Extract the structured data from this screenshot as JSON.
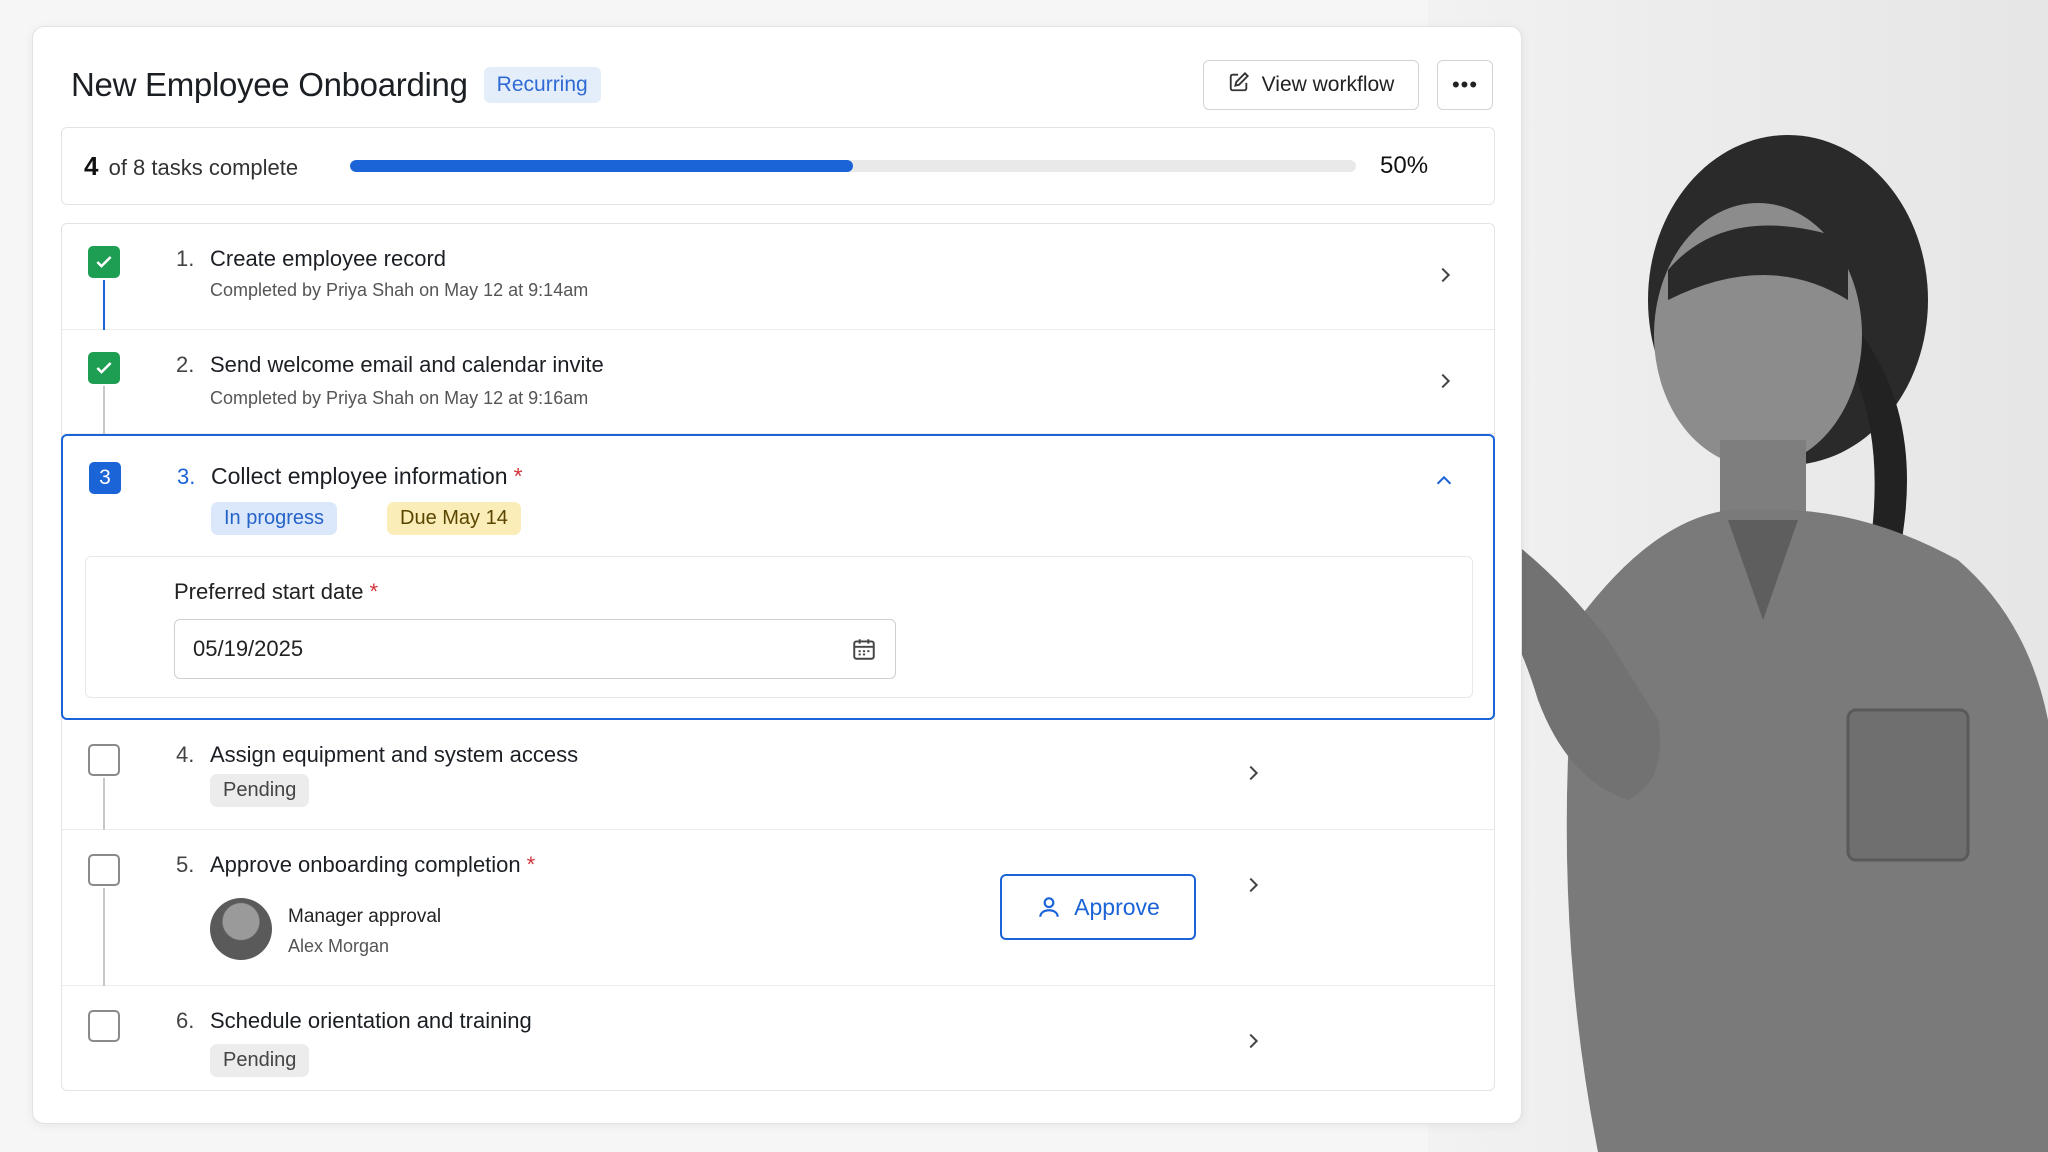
{
  "header": {
    "title": "New Employee Onboarding",
    "badge": "Recurring",
    "view_workflow_label": "View workflow",
    "more_label": "•••"
  },
  "progress": {
    "count": "4",
    "text": "of 8 tasks complete",
    "percent_label": "50%",
    "fraction": 0.5
  },
  "tasks": [
    {
      "num": "1.",
      "title": "Create employee record",
      "sub": "Completed by Priya Shah on May 12 at 9:14am",
      "status": "done"
    },
    {
      "num": "2.",
      "title": "Send welcome email and calendar invite",
      "sub": "Completed by Priya Shah on May 12 at 9:16am",
      "status": "done"
    },
    {
      "num": "3.",
      "box": "3",
      "title": "Collect employee information",
      "required": "*",
      "status": "current",
      "pills": [
        "In progress",
        "Due May 14"
      ],
      "field": {
        "label": "Preferred start date",
        "required": "*",
        "value": "05/19/2025"
      }
    },
    {
      "num": "4.",
      "title": "Assign equipment and system access",
      "pill": "Pending",
      "status": "pending"
    },
    {
      "num": "5.",
      "title": "Approve onboarding completion",
      "required": "*",
      "status": "pending",
      "approver": {
        "role": "Manager approval",
        "name": "Alex Morgan"
      },
      "action_label": "Approve"
    },
    {
      "num": "6.",
      "title": "Schedule orientation and training",
      "pill": "Pending",
      "status": "pending"
    }
  ],
  "colors": {
    "accent": "#1b64d8",
    "done": "#1e9e52",
    "required": "#d1343a"
  },
  "icons": [
    "edit-icon",
    "more-icon",
    "check-icon",
    "chevron-right-icon",
    "chevron-up-icon",
    "calendar-icon",
    "user-icon"
  ]
}
